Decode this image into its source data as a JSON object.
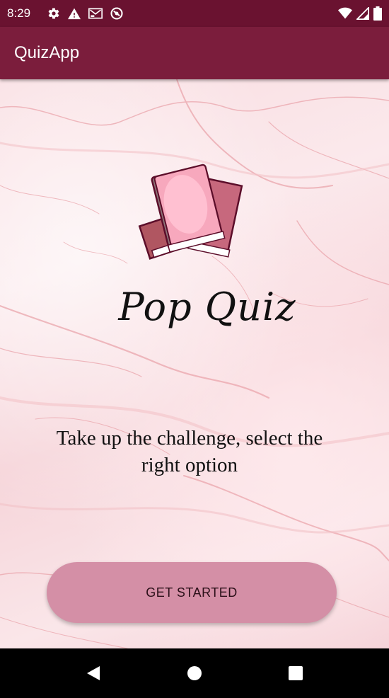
{
  "status_bar": {
    "time": "8:29",
    "left_icons": [
      "settings-icon",
      "warning-icon",
      "gmail-icon",
      "do-not-disturb-icon"
    ],
    "right_icons": [
      "wifi-icon",
      "signal-icon",
      "battery-icon"
    ]
  },
  "app_bar": {
    "title": "QuizApp"
  },
  "main": {
    "logo_icon": "books-icon",
    "quiz_title": "Pop Quiz",
    "tagline": "Take up the challenge, select the right option",
    "start_button_label": "GET STARTED"
  },
  "nav_bar": {
    "buttons": [
      "back-icon",
      "home-icon",
      "recents-icon"
    ]
  },
  "colors": {
    "status_bar": "#6a1230",
    "app_bar": "#7b1d3c",
    "button": "#d48fa6",
    "background": "#f9dde1"
  }
}
